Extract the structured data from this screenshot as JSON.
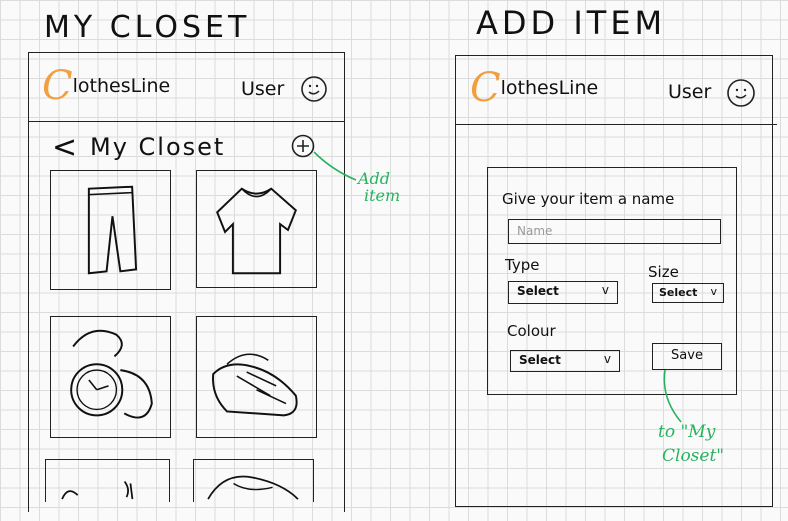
{
  "screens": {
    "closet": {
      "heading": "MY CLOSET",
      "logo": {
        "initial": "C",
        "rest": "lothesLine"
      },
      "user_label": "User",
      "back_label": "<",
      "title": "My Closet",
      "add_annotation": [
        "Add",
        "item"
      ],
      "items": [
        {
          "icon": "pants-icon"
        },
        {
          "icon": "shirt-icon"
        },
        {
          "icon": "watch-icon"
        },
        {
          "icon": "shoes-icon"
        },
        {
          "icon": "clothing-icon"
        },
        {
          "icon": "hat-icon"
        }
      ]
    },
    "add_item": {
      "heading": "ADD ITEM",
      "logo": {
        "initial": "C",
        "rest": "lothesLine"
      },
      "user_label": "User",
      "form": {
        "name_label": "Give your item a name",
        "name_placeholder": "Name",
        "type_label": "Type",
        "type_value": "Select",
        "size_label": "Size",
        "size_value": "Select",
        "colour_label": "Colour",
        "colour_value": "Select",
        "save_label": "Save"
      },
      "save_annotation": [
        "to \"My",
        "Closet\""
      ]
    }
  },
  "colors": {
    "accent_logo": "#f0a040",
    "annotation": "#27b35e",
    "ink": "#222222"
  }
}
